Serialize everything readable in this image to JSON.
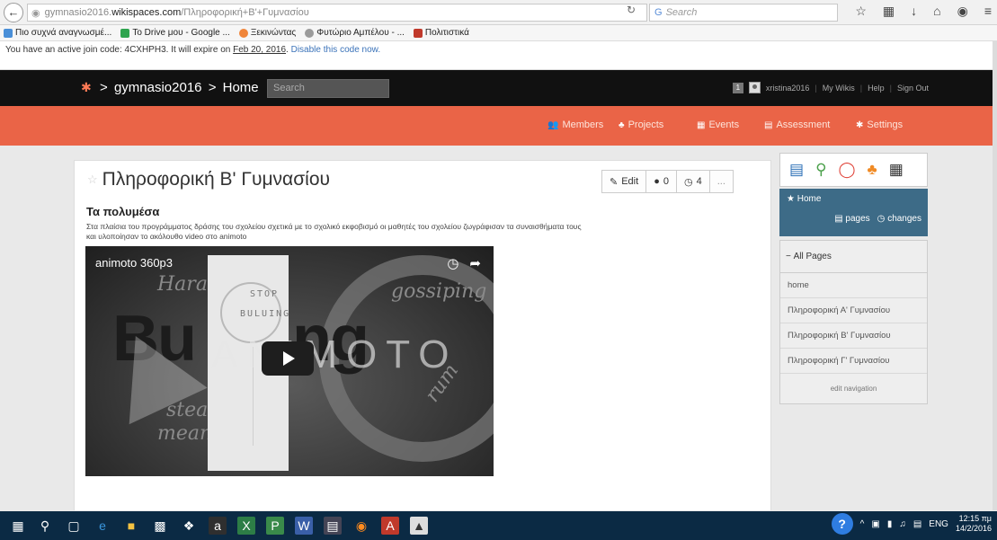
{
  "browser": {
    "url_prefix": "gymnasio2016.",
    "url_domain": "wikispaces.com",
    "url_path": "/Πληροφορική+Β'+Γυμνασίου",
    "search_placeholder": "Search"
  },
  "bookmarks": [
    {
      "label": "Πιο συχνά αναγνωσμέ...",
      "color": "#4a8fd8"
    },
    {
      "label": "To Drive μου - Google ...",
      "color": "#2ea44f"
    },
    {
      "label": "Ξεκινώντας",
      "color": "#f0853a"
    },
    {
      "label": "Φυτώριο Αμπέλου - ...",
      "color": "#9b9b9b"
    },
    {
      "label": "Πολιτιστικά",
      "color": "#c0392b"
    }
  ],
  "joinbar": {
    "text": "You have an active join code: 4CXHPH3. It will expire on ",
    "date": "Feb 20, 2016",
    "sep": ". ",
    "disable": "Disable this code now."
  },
  "topnav": {
    "breadcrumb_sep": ">",
    "wiki": "gymnasio2016",
    "page": "Home",
    "search_placeholder": "Search",
    "badge": "1",
    "username": "xristina2016",
    "links": [
      "My Wikis",
      "Help",
      "Sign Out"
    ]
  },
  "orangenav": [
    {
      "icon": "members-icon",
      "glyph": "👥",
      "label": "Members"
    },
    {
      "icon": "projects-icon",
      "glyph": "♣",
      "label": "Projects"
    },
    {
      "icon": "events-icon",
      "glyph": "▦",
      "label": "Events"
    },
    {
      "icon": "assessment-icon",
      "glyph": "▤",
      "label": "Assessment"
    },
    {
      "icon": "settings-icon",
      "glyph": "✱",
      "label": "Settings"
    }
  ],
  "page": {
    "title": "Πληροφορική Β' Γυμνασίου",
    "edit_label": "Edit",
    "comments_count": "0",
    "history_count": "4",
    "more_label": "...",
    "section_heading": "Τα πολυμέσα",
    "desc_line1": "Στα πλαίσια του προγράμματος δράσης του σχολείου σχετικά με το σχολικό εκφοβισμό οι μαθητές του σχολείου ζωγράφισαν τα συναισθήματα τους",
    "desc_line2": "και υλοποίησαν το ακόλουθο video στο animoto"
  },
  "video": {
    "title": "animoto 360p3",
    "watermark": "ANIMOTO",
    "stop_top": "STOP",
    "stop_bottom": "BULUING"
  },
  "sidebar": {
    "home_label": "Home",
    "pages_label": "pages",
    "changes_label": "changes",
    "all_pages_label": "All Pages",
    "items": [
      "home",
      "Πληροφορική Α' Γυμνασίου",
      "Πληροφορική Β' Γυμνασίου",
      "Πληροφορική Γ' Γυμνασίου"
    ],
    "edit_nav": "edit navigation"
  },
  "taskbar": {
    "lang": "ENG",
    "time": "12:15 πμ",
    "date": "14/2/2016"
  },
  "colors": {
    "topnav_bg": "#111111",
    "orange_bar": "#ea6447",
    "home_box": "#3d6b87",
    "taskbar": "#0b2a44"
  }
}
